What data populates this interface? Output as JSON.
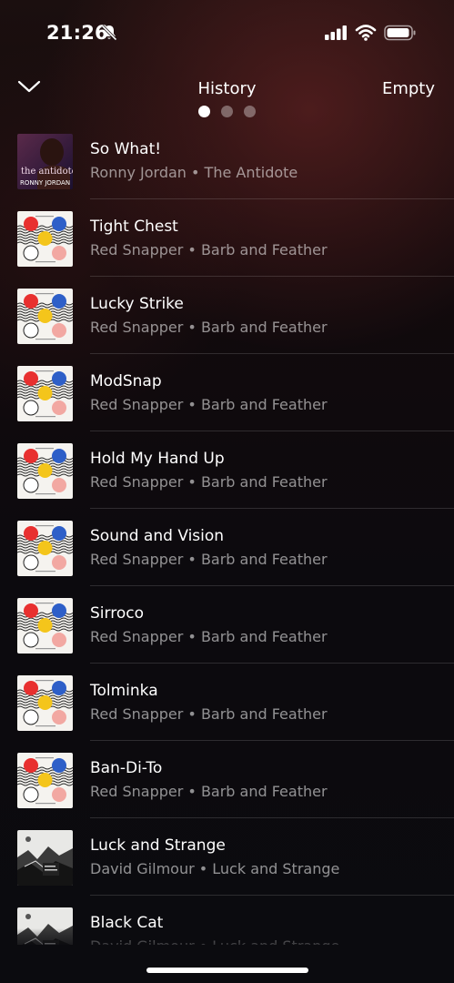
{
  "status_bar": {
    "time": "21:26",
    "icons": [
      "bell-slash-icon",
      "signal-icon",
      "wifi-icon",
      "battery-icon"
    ]
  },
  "header": {
    "title": "History",
    "action_label": "Empty",
    "back_icon": "chevron-down-icon",
    "page_dots": 3,
    "active_dot": 0
  },
  "tracks": [
    {
      "title": "So What!",
      "artist": "Ronny Jordan",
      "album": "The Antidote",
      "art": "antidote",
      "art_text": [
        "the antidote",
        "RONNY JORDAN"
      ]
    },
    {
      "title": "Tight Chest",
      "artist": "Red Snapper",
      "album": "Barb and Feather",
      "art": "barb"
    },
    {
      "title": "Lucky Strike",
      "artist": "Red Snapper",
      "album": "Barb and Feather",
      "art": "barb"
    },
    {
      "title": "ModSnap",
      "artist": "Red Snapper",
      "album": "Barb and Feather",
      "art": "barb"
    },
    {
      "title": "Hold My Hand Up",
      "artist": "Red Snapper",
      "album": "Barb and Feather",
      "art": "barb"
    },
    {
      "title": "Sound and Vision",
      "artist": "Red Snapper",
      "album": "Barb and Feather",
      "art": "barb"
    },
    {
      "title": "Sirroco",
      "artist": "Red Snapper",
      "album": "Barb and Feather",
      "art": "barb"
    },
    {
      "title": "Tolminka",
      "artist": "Red Snapper",
      "album": "Barb and Feather",
      "art": "barb"
    },
    {
      "title": "Ban-Di-To",
      "artist": "Red Snapper",
      "album": "Barb and Feather",
      "art": "barb"
    },
    {
      "title": "Luck and Strange",
      "artist": "David Gilmour",
      "album": "Luck and Strange",
      "art": "luck"
    },
    {
      "title": "Black Cat",
      "artist": "David Gilmour",
      "album": "Luck and Strange",
      "art": "luck"
    }
  ],
  "separator": " • ",
  "colors": {
    "accent_red": "#e8302f",
    "accent_blue": "#2e5fc8",
    "accent_yellow": "#f4c51b",
    "accent_pink": "#f2a8a2"
  }
}
